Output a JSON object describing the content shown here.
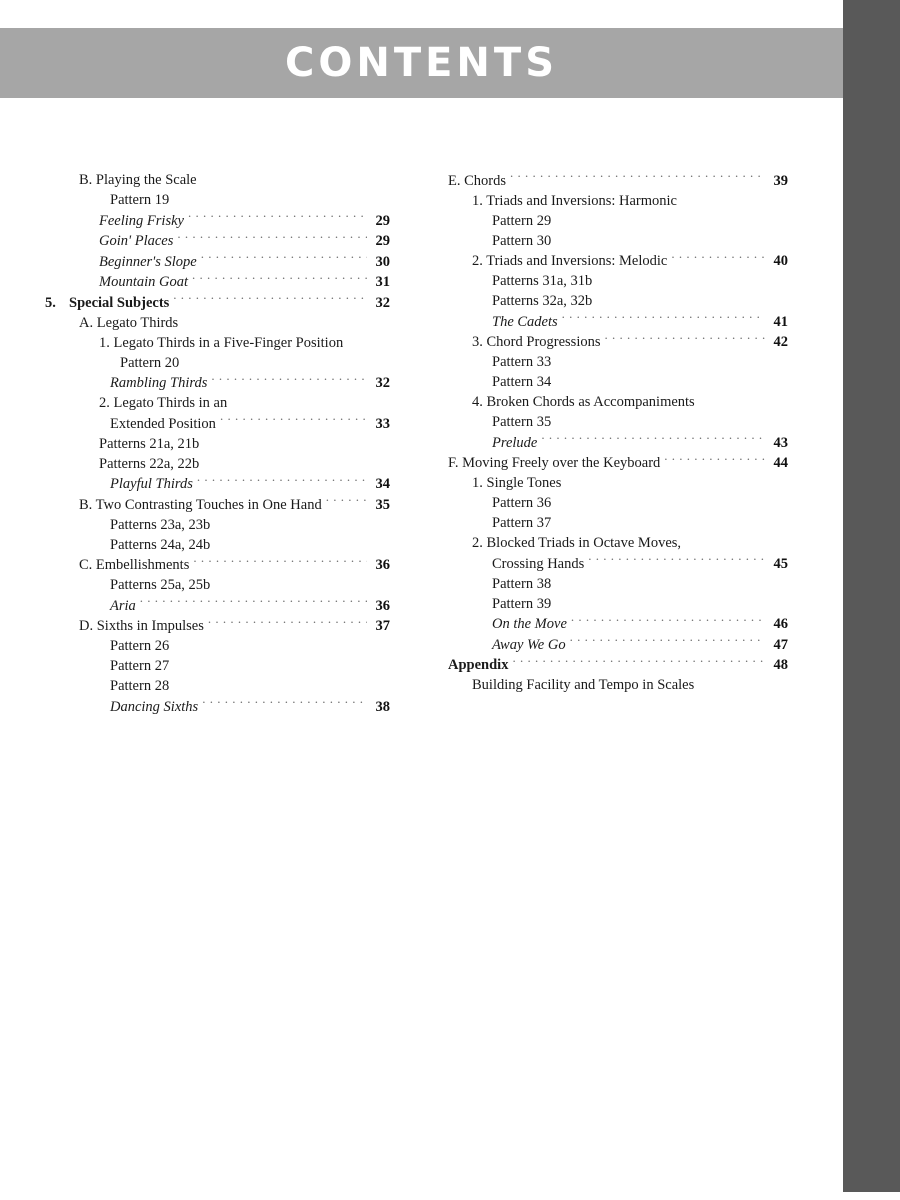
{
  "page": {
    "title": "CONTENTS",
    "banner_color": "#a6a6a6",
    "edge_strip_color": "#595959",
    "title_color": "#ffffff",
    "background_color": "#ffffff"
  },
  "toc": {
    "left_column": [
      {
        "marker": "",
        "label": "B. Playing the Scale",
        "page": "",
        "indent": 1,
        "style": "normal"
      },
      {
        "marker": "",
        "label": "Pattern 19",
        "page": "",
        "indent": 3,
        "style": "normal"
      },
      {
        "marker": "",
        "label": "Feeling Frisky",
        "page": "29",
        "indent": 2,
        "style": "italic"
      },
      {
        "marker": "",
        "label": "Goin' Places",
        "page": "29",
        "indent": 2,
        "style": "italic"
      },
      {
        "marker": "",
        "label": "Beginner's Slope",
        "page": "30",
        "indent": 2,
        "style": "italic"
      },
      {
        "marker": "",
        "label": "Mountain Goat",
        "page": "31",
        "indent": 2,
        "style": "italic"
      },
      {
        "marker": "5.",
        "label": "Special Subjects",
        "page": "32",
        "indent": 0,
        "style": "bold"
      },
      {
        "marker": "",
        "label": "A. Legato Thirds",
        "page": "",
        "indent": 1,
        "style": "normal"
      },
      {
        "marker": "",
        "label": "1. Legato Thirds in a Five-Finger Position",
        "page": "",
        "indent": 2,
        "style": "normal"
      },
      {
        "marker": "",
        "label": "Pattern 20",
        "page": "",
        "indent": 4,
        "style": "normal"
      },
      {
        "marker": "",
        "label": "Rambling Thirds",
        "page": "32",
        "indent": 3,
        "style": "italic"
      },
      {
        "marker": "",
        "label": "2. Legato Thirds in an",
        "page": "",
        "indent": 2,
        "style": "normal"
      },
      {
        "marker": "",
        "label": "Extended Position",
        "page": "33",
        "indent": 3,
        "style": "normal"
      },
      {
        "marker": "",
        "label": "Patterns 21a, 21b",
        "page": "",
        "indent": 2,
        "style": "normal"
      },
      {
        "marker": "",
        "label": "Patterns 22a, 22b",
        "page": "",
        "indent": 2,
        "style": "normal"
      },
      {
        "marker": "",
        "label": "Playful Thirds",
        "page": "34",
        "indent": 3,
        "style": "italic"
      },
      {
        "marker": "",
        "label": "B. Two Contrasting Touches in One Hand",
        "page": "35",
        "indent": 1,
        "style": "normal"
      },
      {
        "marker": "",
        "label": "Patterns 23a, 23b",
        "page": "",
        "indent": 3,
        "style": "normal"
      },
      {
        "marker": "",
        "label": "Patterns 24a, 24b",
        "page": "",
        "indent": 3,
        "style": "normal"
      },
      {
        "marker": "",
        "label": "C. Embellishments",
        "page": "36",
        "indent": 1,
        "style": "normal"
      },
      {
        "marker": "",
        "label": "Patterns 25a, 25b",
        "page": "",
        "indent": 3,
        "style": "normal"
      },
      {
        "marker": "",
        "label": "Aria",
        "page": "36",
        "indent": 3,
        "style": "italic"
      },
      {
        "marker": "",
        "label": "D. Sixths in Impulses",
        "page": "37",
        "indent": 1,
        "style": "normal"
      },
      {
        "marker": "",
        "label": "Pattern 26",
        "page": "",
        "indent": 3,
        "style": "normal"
      },
      {
        "marker": "",
        "label": "Pattern 27",
        "page": "",
        "indent": 3,
        "style": "normal"
      },
      {
        "marker": "",
        "label": "Pattern 28",
        "page": "",
        "indent": 3,
        "style": "normal"
      },
      {
        "marker": "",
        "label": "Dancing Sixths",
        "page": "38",
        "indent": 3,
        "style": "italic"
      }
    ],
    "right_column": [
      {
        "marker": "",
        "label": "E. Chords",
        "page": "39",
        "indent": 0,
        "style": "normal"
      },
      {
        "marker": "",
        "label": "1. Triads and Inversions:  Harmonic",
        "page": "",
        "indent": 1,
        "style": "normal"
      },
      {
        "marker": "",
        "label": "Pattern 29",
        "page": "",
        "indent": 2,
        "style": "normal"
      },
      {
        "marker": "",
        "label": "Pattern 30",
        "page": "",
        "indent": 2,
        "style": "normal"
      },
      {
        "marker": "",
        "label": "2. Triads and Inversions:  Melodic",
        "page": "40",
        "indent": 1,
        "style": "normal"
      },
      {
        "marker": "",
        "label": "Patterns 31a, 31b",
        "page": "",
        "indent": 2,
        "style": "normal"
      },
      {
        "marker": "",
        "label": "Patterns 32a, 32b",
        "page": "",
        "indent": 2,
        "style": "normal"
      },
      {
        "marker": "",
        "label": "The Cadets",
        "page": "41",
        "indent": 2,
        "style": "italic"
      },
      {
        "marker": "",
        "label": "3. Chord Progressions",
        "page": "42",
        "indent": 1,
        "style": "normal"
      },
      {
        "marker": "",
        "label": "Pattern 33",
        "page": "",
        "indent": 2,
        "style": "normal"
      },
      {
        "marker": "",
        "label": "Pattern 34",
        "page": "",
        "indent": 2,
        "style": "normal"
      },
      {
        "marker": "",
        "label": "4. Broken Chords as Accompaniments",
        "page": "",
        "indent": 1,
        "style": "normal"
      },
      {
        "marker": "",
        "label": "Pattern 35",
        "page": "",
        "indent": 2,
        "style": "normal"
      },
      {
        "marker": "",
        "label": "Prelude",
        "page": "43",
        "indent": 2,
        "style": "italic"
      },
      {
        "marker": "",
        "label": "F. Moving Freely over the Keyboard",
        "page": "44",
        "indent": 0,
        "style": "normal"
      },
      {
        "marker": "",
        "label": "1. Single Tones",
        "page": "",
        "indent": 1,
        "style": "normal"
      },
      {
        "marker": "",
        "label": "Pattern 36",
        "page": "",
        "indent": 2,
        "style": "normal"
      },
      {
        "marker": "",
        "label": "Pattern 37",
        "page": "",
        "indent": 2,
        "style": "normal"
      },
      {
        "marker": "",
        "label": "2. Blocked Triads in Octave Moves,",
        "page": "",
        "indent": 1,
        "style": "normal"
      },
      {
        "marker": "",
        "label": "Crossing Hands",
        "page": "45",
        "indent": 2,
        "style": "normal"
      },
      {
        "marker": "",
        "label": "Pattern 38",
        "page": "",
        "indent": 2,
        "style": "normal"
      },
      {
        "marker": "",
        "label": "Pattern 39",
        "page": "",
        "indent": 2,
        "style": "normal"
      },
      {
        "marker": "",
        "label": "On the Move",
        "page": "46",
        "indent": 2,
        "style": "italic"
      },
      {
        "marker": "",
        "label": "Away We Go",
        "page": "47",
        "indent": 2,
        "style": "italic"
      },
      {
        "marker": "",
        "label": "Appendix",
        "page": "48",
        "indent": 0,
        "style": "bold"
      },
      {
        "marker": "",
        "label": "Building Facility and Tempo in Scales",
        "page": "",
        "indent": 1,
        "style": "normal"
      }
    ]
  }
}
